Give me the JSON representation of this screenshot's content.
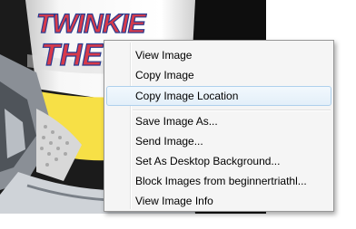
{
  "photo": {
    "caption_lines": [
      "TWINKIE",
      "THE"
    ],
    "sock_color": "#f7e046",
    "text_color": "#d83a4a"
  },
  "context_menu": {
    "items": [
      {
        "label": "View Image",
        "selected": false
      },
      {
        "label": "Copy Image",
        "selected": false
      },
      {
        "label": "Copy Image Location",
        "selected": true
      },
      {
        "label": "Save Image As...",
        "selected": false
      },
      {
        "label": "Send Image...",
        "selected": false
      },
      {
        "label": "Set As Desktop Background...",
        "selected": false
      },
      {
        "label": "Block Images from beginnertriathl...",
        "selected": false
      },
      {
        "label": "View Image Info",
        "selected": false
      }
    ]
  },
  "colors": {
    "menu_background": "#f5f5f5",
    "highlight_border": "#aed0ec",
    "highlight_fill": "#e3eff9"
  }
}
